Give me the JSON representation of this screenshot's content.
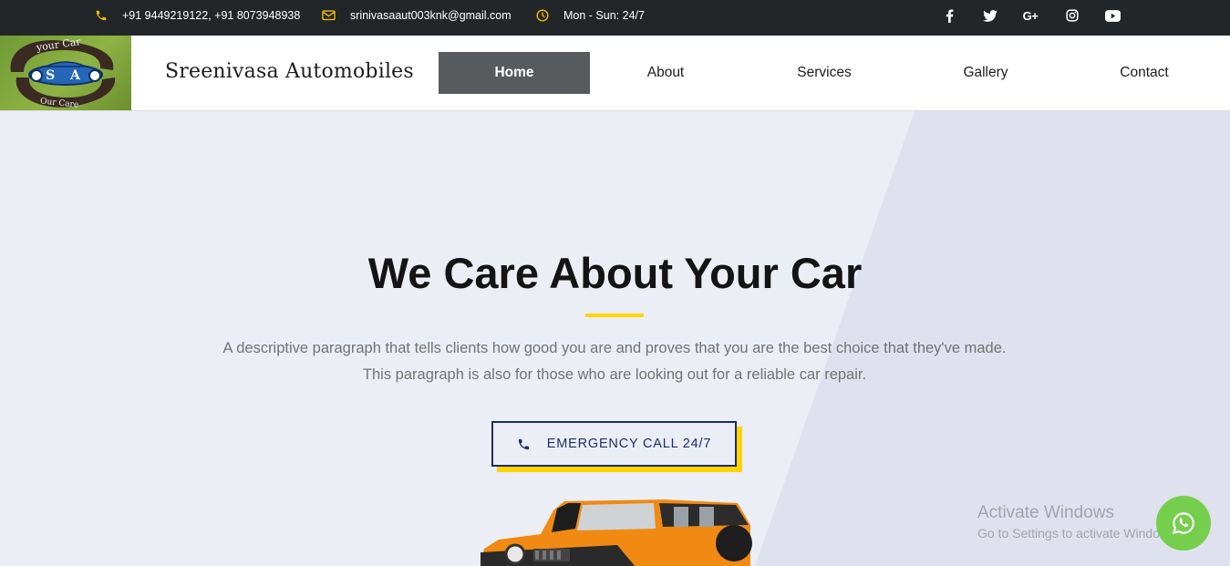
{
  "topbar": {
    "phone": "+91 9449219122, +91 8073948938",
    "email": "srinivasaaut003knk@gmail.com",
    "hours": "Mon - Sun: 24/7",
    "contact_icons": [
      "phone-icon",
      "envelope-icon",
      "clock-icon"
    ],
    "social_icons": [
      "facebook-icon",
      "twitter-icon",
      "google-plus-icon",
      "instagram-icon",
      "youtube-icon"
    ]
  },
  "header": {
    "logo": {
      "top_text": "your Car",
      "center_text": "S A",
      "bottom_text": "Our Care"
    },
    "brand": "Sreenivasa Automobiles",
    "nav": [
      "Home",
      "About",
      "Services",
      "Gallery",
      "Contact"
    ],
    "active_nav": "Home"
  },
  "hero": {
    "title": "We Care About Your Car",
    "description": "A descriptive paragraph that tells clients how good you are and proves that you are the best choice that they've made. This paragraph is also for those who are looking out for a reliable car repair.",
    "cta_label": "EMERGENCY CALL 24/7",
    "cta_icon": "phone-icon"
  },
  "watermark": {
    "title": "Activate Windows",
    "subtitle": "Go to Settings to activate Windows."
  },
  "floating": {
    "icon": "whatsapp-icon"
  },
  "colors": {
    "topbar_bg": "#232628",
    "accent_yellow": "#ffd400",
    "nav_active_bg": "#585b5e",
    "cta_blue": "#1d2c6e",
    "hero_bg": "#eceef5",
    "hero_shape": "#dfe2ee",
    "whatsapp_green": "#75cf4c"
  }
}
